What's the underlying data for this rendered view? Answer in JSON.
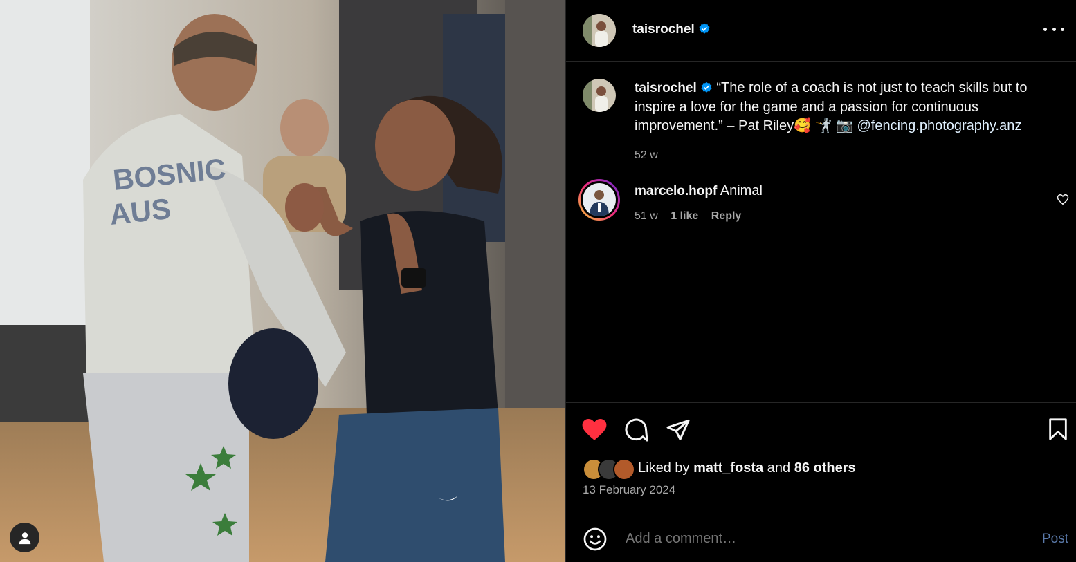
{
  "post": {
    "author": "taisrochel",
    "verified": true,
    "photo_tags": [
      "BOSNIC",
      "AUS"
    ]
  },
  "caption": {
    "author": "taisrochel",
    "text": "“The role of a coach is not just to teach skills but to inspire a love for the game and a passion for continuous improvement.” – Pat Riley🥰 🤺 📷 ",
    "mention": "@fencing.photography.anz",
    "age": "52 w"
  },
  "comments": [
    {
      "author": "marcelo.hopf",
      "text": "Animal",
      "age": "51 w",
      "likes": "1 like",
      "reply_label": "Reply"
    }
  ],
  "engagement": {
    "liked_prefix": "Liked by",
    "liked_user": "matt_fosta",
    "and_label": "and",
    "others": "86 others",
    "date": "13 February 2024",
    "liked": true
  },
  "comment_box": {
    "placeholder": "Add a comment…",
    "post_label": "Post"
  },
  "colors": {
    "background": "#000000",
    "like_red": "#ff3040",
    "verified_blue": "#0095f6",
    "post_button": "#5a79a9",
    "divider": "#262626"
  },
  "icons": [
    "user-icon",
    "more-icon",
    "verified-icon",
    "heart-icon",
    "comment-icon",
    "share-icon",
    "bookmark-icon",
    "emoji-icon",
    "small-heart-icon"
  ]
}
